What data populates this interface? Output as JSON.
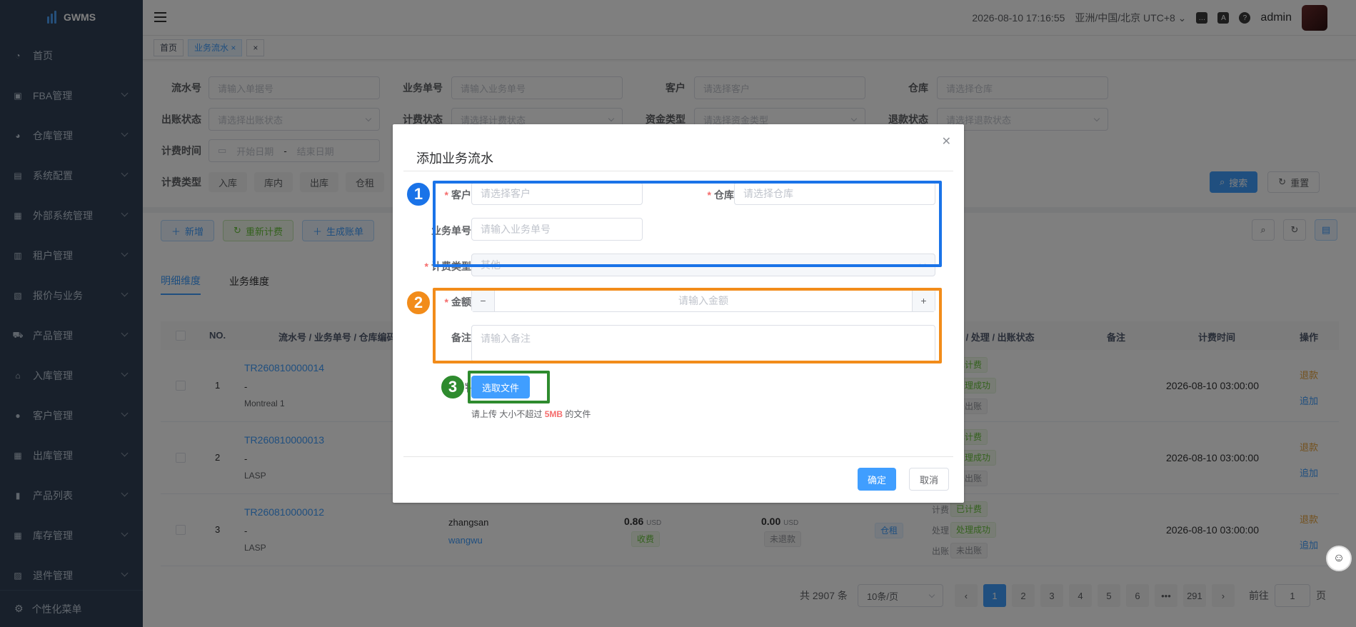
{
  "app": {
    "name": "GWMS"
  },
  "sidebar": {
    "items": [
      {
        "label": "首页",
        "icon": "dashboard-icon",
        "glyph": "◔"
      },
      {
        "label": "FBA管理",
        "icon": "fba-icon",
        "glyph": "▣"
      },
      {
        "label": "仓库管理",
        "icon": "warehouse-icon",
        "glyph": "◕"
      },
      {
        "label": "系统配置",
        "icon": "config-icon",
        "glyph": "▤"
      },
      {
        "label": "外部系统管理",
        "icon": "grid-icon",
        "glyph": "▦"
      },
      {
        "label": "租户管理",
        "icon": "chart-icon",
        "glyph": "▥"
      },
      {
        "label": "报价与业务",
        "icon": "quote-icon",
        "glyph": "▧"
      },
      {
        "label": "产品管理",
        "icon": "cart-icon",
        "glyph": "⛟"
      },
      {
        "label": "入库管理",
        "icon": "home-icon",
        "glyph": "⌂"
      },
      {
        "label": "客户管理",
        "icon": "user-icon",
        "glyph": "●"
      },
      {
        "label": "出库管理",
        "icon": "grid-icon",
        "glyph": "▦"
      },
      {
        "label": "产品列表",
        "icon": "book-icon",
        "glyph": "▮"
      },
      {
        "label": "库存管理",
        "icon": "table-icon",
        "glyph": "▦"
      },
      {
        "label": "退件管理",
        "icon": "return-icon",
        "glyph": "▨"
      }
    ],
    "bottom_label": "个性化菜单"
  },
  "header": {
    "datetime": "2026-08-10 17:16:55",
    "timezone": "亚洲/中国/北京 UTC+8",
    "user": "admin"
  },
  "tags": [
    {
      "label": "首页"
    },
    {
      "label": "业务流水"
    }
  ],
  "filters": {
    "serial_label": "流水号",
    "serial_ph": "请输入单据号",
    "bizno_label": "业务单号",
    "bizno_ph": "请输入业务单号",
    "customer_label": "客户",
    "customer_ph": "请选择客户",
    "warehouse_label": "仓库",
    "warehouse_ph": "请选择仓库",
    "bill_status_label": "出账状态",
    "bill_status_ph": "请选择出账状态",
    "charge_status_label": "计费状态",
    "charge_status_ph": "请选择计费状态",
    "fund_type_label": "资金类型",
    "fund_type_ph": "请选择资金类型",
    "refund_status_label": "退款状态",
    "refund_status_ph": "请选择退款状态",
    "charge_time_label": "计费时间",
    "start_ph": "开始日期",
    "end_ph": "结束日期",
    "range_sep": "-",
    "charge_type_label": "计费类型",
    "charge_types": [
      "入库",
      "库内",
      "出库",
      "仓租"
    ],
    "search": "搜索",
    "reset": "重置"
  },
  "toolbar": {
    "add": "新增",
    "recalc": "重新计费",
    "gen_bill": "生成账单"
  },
  "tabs": [
    "明细维度",
    "业务维度"
  ],
  "table": {
    "headers": {
      "no": "NO.",
      "serial": "流水号 / 业务单号 / 仓库编码",
      "status": "计费 / 处理 / 出账状态",
      "remark": "备注",
      "time": "计费时间",
      "ops": "操作"
    },
    "status_labels": [
      "计费",
      "处理",
      "出账"
    ],
    "rows": [
      {
        "no": "1",
        "serial": "TR260810000014",
        "biz": "-",
        "wh": "Montreal 1",
        "s1": "已计费",
        "s2": "处理成功",
        "s3": "未出账",
        "time": "2026-08-10 03:00:00",
        "op1": "退款",
        "op2": "追加"
      },
      {
        "no": "2",
        "serial": "TR260810000013",
        "biz": "-",
        "wh": "LASP",
        "s1": "已计费",
        "s2": "处理成功",
        "s3": "未出账",
        "time": "2026-08-10 03:00:00",
        "op1": "退款",
        "op2": "追加"
      },
      {
        "no": "3",
        "serial": "TR260810000012",
        "biz": "-",
        "wh": "LASP",
        "customer": "zhangsan",
        "customer2": "wangwu",
        "amount": "0.86",
        "currency": "USD",
        "fund_tag": "收费",
        "refund": "0.00",
        "refund_currency": "USD",
        "refund_tag": "未退款",
        "type_tag": "仓租",
        "s1": "已计费",
        "s2": "处理成功",
        "s3": "未出账",
        "time": "2026-08-10 03:00:00",
        "op1": "退款",
        "op2": "追加"
      }
    ]
  },
  "pagination": {
    "total": "共 2907 条",
    "page_size": "10条/页",
    "pages": [
      "1",
      "2",
      "3",
      "4",
      "5",
      "6",
      "•••",
      "291"
    ],
    "goto": "前往",
    "goto_value": "1",
    "page_suffix": "页"
  },
  "dialog": {
    "title": "添加业务流水",
    "customer_label": "客户",
    "customer_ph": "请选择客户",
    "warehouse_label": "仓库",
    "warehouse_ph": "请选择仓库",
    "bizno_label": "业务单号",
    "bizno_ph": "请输入业务单号",
    "charge_type_label": "计费类型",
    "charge_type_value": "其他",
    "amount_label": "金额",
    "amount_ph": "请输入金额",
    "remark_label": "备注",
    "remark_ph": "请输入备注",
    "attach_label": "附件",
    "upload_button": "选取文件",
    "upload_tip_pre": "请上传 大小不超过",
    "upload_tip_size": "5MB",
    "upload_tip_post": "的文件",
    "confirm": "确定",
    "cancel": "取消"
  },
  "annotations": [
    {
      "number": "1",
      "color": "#1a73e8"
    },
    {
      "number": "2",
      "color": "#f28c1a"
    },
    {
      "number": "3",
      "color": "#2e8b2e"
    }
  ]
}
